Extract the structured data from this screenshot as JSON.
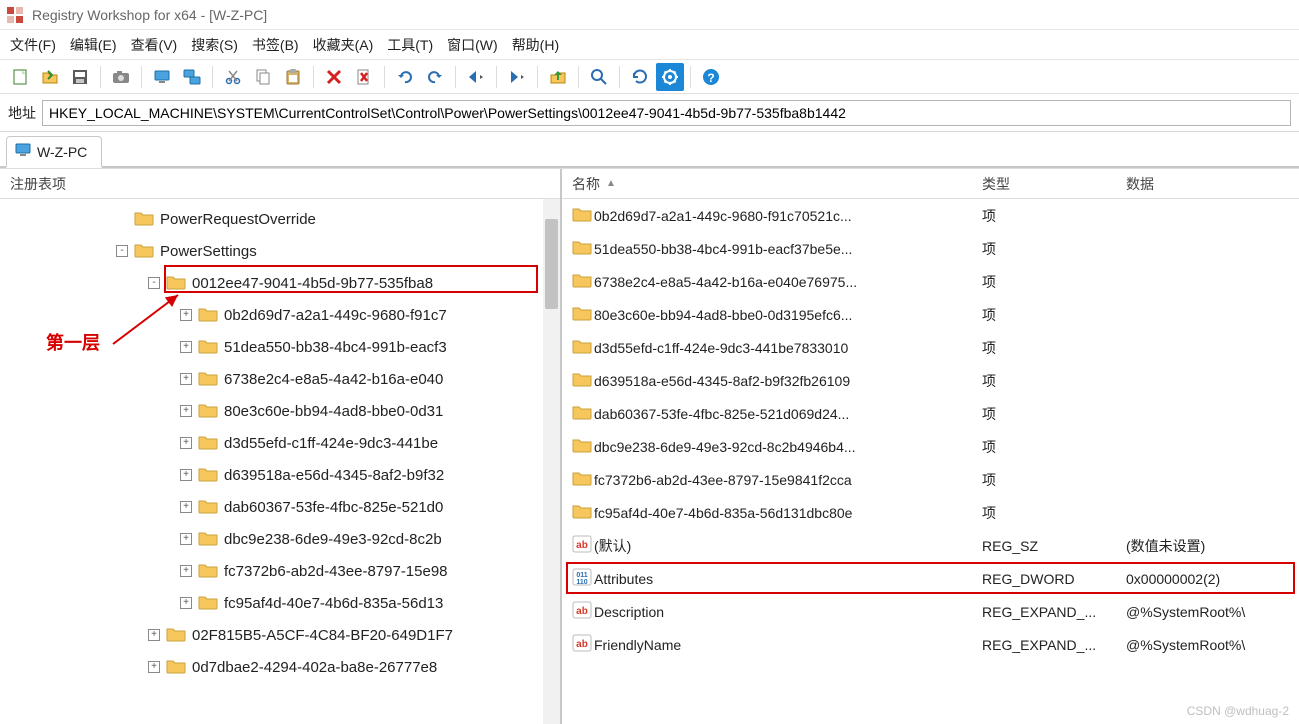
{
  "window": {
    "title": "Registry Workshop for x64 - [W-Z-PC]"
  },
  "menus": [
    {
      "label": "文件(F)"
    },
    {
      "label": "编辑(E)"
    },
    {
      "label": "查看(V)"
    },
    {
      "label": "搜索(S)"
    },
    {
      "label": "书签(B)"
    },
    {
      "label": "收藏夹(A)"
    },
    {
      "label": "工具(T)"
    },
    {
      "label": "窗口(W)"
    },
    {
      "label": "帮助(H)"
    }
  ],
  "address": {
    "label": "地址",
    "value": "HKEY_LOCAL_MACHINE\\SYSTEM\\CurrentControlSet\\Control\\Power\\PowerSettings\\0012ee47-9041-4b5d-9b77-535fba8b1442"
  },
  "tab": {
    "label": "W-Z-PC"
  },
  "left_header": "注册表项",
  "right_header": {
    "name": "名称",
    "type": "类型",
    "data": "数据"
  },
  "annotation": {
    "label": "第一层"
  },
  "tree": [
    {
      "indent": 3,
      "exp": "",
      "label": "PowerRequestOverride"
    },
    {
      "indent": 3,
      "exp": "-",
      "label": "PowerSettings"
    },
    {
      "indent": 4,
      "exp": "-",
      "label": "0012ee47-9041-4b5d-9b77-535fba8",
      "highlight": true
    },
    {
      "indent": 5,
      "exp": "+",
      "label": "0b2d69d7-a2a1-449c-9680-f91c7"
    },
    {
      "indent": 5,
      "exp": "+",
      "label": "51dea550-bb38-4bc4-991b-eacf3"
    },
    {
      "indent": 5,
      "exp": "+",
      "label": "6738e2c4-e8a5-4a42-b16a-e040"
    },
    {
      "indent": 5,
      "exp": "+",
      "label": "80e3c60e-bb94-4ad8-bbe0-0d31"
    },
    {
      "indent": 5,
      "exp": "+",
      "label": "d3d55efd-c1ff-424e-9dc3-441be"
    },
    {
      "indent": 5,
      "exp": "+",
      "label": "d639518a-e56d-4345-8af2-b9f32"
    },
    {
      "indent": 5,
      "exp": "+",
      "label": "dab60367-53fe-4fbc-825e-521d0"
    },
    {
      "indent": 5,
      "exp": "+",
      "label": "dbc9e238-6de9-49e3-92cd-8c2b"
    },
    {
      "indent": 5,
      "exp": "+",
      "label": "fc7372b6-ab2d-43ee-8797-15e98"
    },
    {
      "indent": 5,
      "exp": "+",
      "label": "fc95af4d-40e7-4b6d-835a-56d13"
    },
    {
      "indent": 4,
      "exp": "+",
      "label": "02F815B5-A5CF-4C84-BF20-649D1F7"
    },
    {
      "indent": 4,
      "exp": "+",
      "label": "0d7dbae2-4294-402a-ba8e-26777e8"
    }
  ],
  "values": [
    {
      "icon": "folder",
      "name": "0b2d69d7-a2a1-449c-9680-f91c70521c...",
      "type": "项",
      "data": ""
    },
    {
      "icon": "folder",
      "name": "51dea550-bb38-4bc4-991b-eacf37be5e...",
      "type": "项",
      "data": ""
    },
    {
      "icon": "folder",
      "name": "6738e2c4-e8a5-4a42-b16a-e040e76975...",
      "type": "项",
      "data": ""
    },
    {
      "icon": "folder",
      "name": "80e3c60e-bb94-4ad8-bbe0-0d3195efc6...",
      "type": "项",
      "data": ""
    },
    {
      "icon": "folder",
      "name": "d3d55efd-c1ff-424e-9dc3-441be7833010",
      "type": "项",
      "data": ""
    },
    {
      "icon": "folder",
      "name": "d639518a-e56d-4345-8af2-b9f32fb26109",
      "type": "项",
      "data": ""
    },
    {
      "icon": "folder",
      "name": "dab60367-53fe-4fbc-825e-521d069d24...",
      "type": "项",
      "data": ""
    },
    {
      "icon": "folder",
      "name": "dbc9e238-6de9-49e3-92cd-8c2b4946b4...",
      "type": "项",
      "data": ""
    },
    {
      "icon": "folder",
      "name": "fc7372b6-ab2d-43ee-8797-15e9841f2cca",
      "type": "项",
      "data": ""
    },
    {
      "icon": "folder",
      "name": "fc95af4d-40e7-4b6d-835a-56d131dbc80e",
      "type": "项",
      "data": ""
    },
    {
      "icon": "string",
      "name": "(默认)",
      "type": "REG_SZ",
      "data": "(数值未设置)"
    },
    {
      "icon": "binary",
      "name": "Attributes",
      "type": "REG_DWORD",
      "data": "0x00000002(2)",
      "highlight": true
    },
    {
      "icon": "string",
      "name": "Description",
      "type": "REG_EXPAND_...",
      "data": "@%SystemRoot%\\"
    },
    {
      "icon": "string",
      "name": "FriendlyName",
      "type": "REG_EXPAND_...",
      "data": "@%SystemRoot%\\"
    }
  ],
  "watermark": "CSDN @wdhuag-2"
}
